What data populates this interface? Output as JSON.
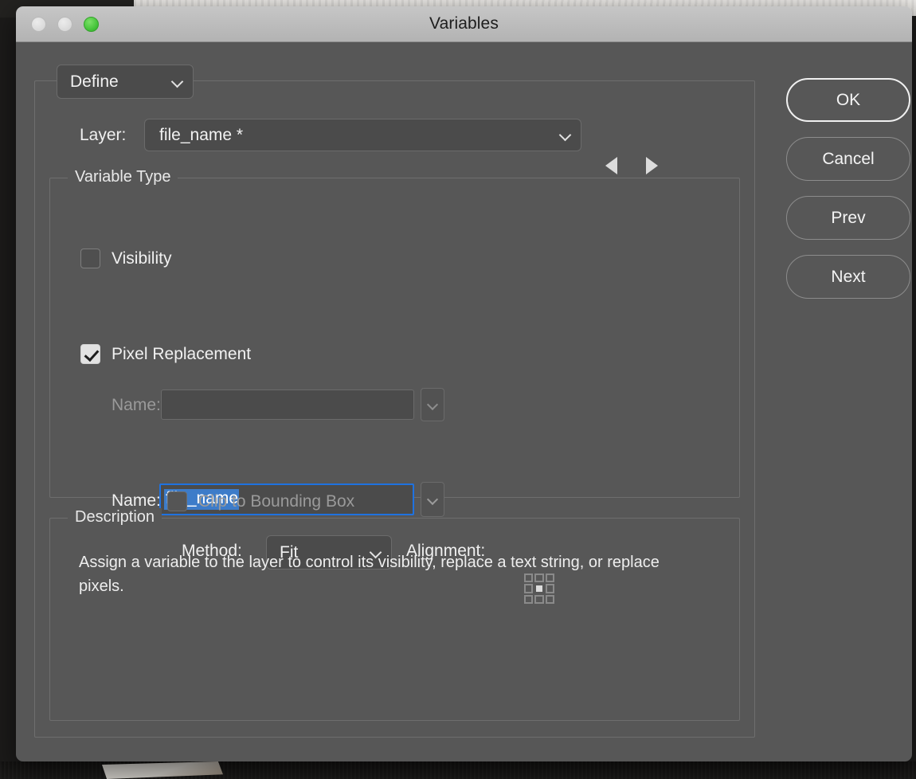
{
  "window": {
    "title": "Variables",
    "traffic_lights": [
      {
        "name": "close",
        "color": "#dcdcdc"
      },
      {
        "name": "minimize",
        "color": "#dcdcdc"
      },
      {
        "name": "zoom",
        "color": "#45c43a"
      }
    ]
  },
  "define": {
    "label": "Define",
    "icon": "chevron-down-icon"
  },
  "layer": {
    "label": "Layer:",
    "value": "file_name *",
    "prev_icon": "triangle-left-icon",
    "next_icon": "triangle-right-icon"
  },
  "variable_type": {
    "legend": "Variable Type",
    "visibility": {
      "label": "Visibility",
      "checked": false,
      "name_label": "Name:",
      "name_value": "",
      "name_placeholder": "",
      "disabled": true
    },
    "pixel_replacement": {
      "label": "Pixel Replacement",
      "checked": true,
      "name_label": "Name:",
      "name_value": "file_name",
      "selected": true
    },
    "method": {
      "label": "Method:",
      "value": "Fit"
    },
    "alignment": {
      "label": "Alignment:",
      "selected_cell": "center"
    },
    "clip": {
      "label": "Clip to Bounding Box",
      "checked": false,
      "disabled": true
    }
  },
  "description": {
    "legend": "Description",
    "text": "Assign a variable to the layer to control its visibility, replace a text string, or replace pixels."
  },
  "buttons": {
    "ok": "OK",
    "cancel": "Cancel",
    "prev": "Prev",
    "next": "Next"
  },
  "colors": {
    "dialog_bg": "#575757",
    "titlebar_bg": "#bdbdbd",
    "field_bg": "#4b4b4b",
    "focus_ring": "#1f72e0",
    "selection": "#3d7cc9",
    "zoom_light": "#45c43a"
  }
}
